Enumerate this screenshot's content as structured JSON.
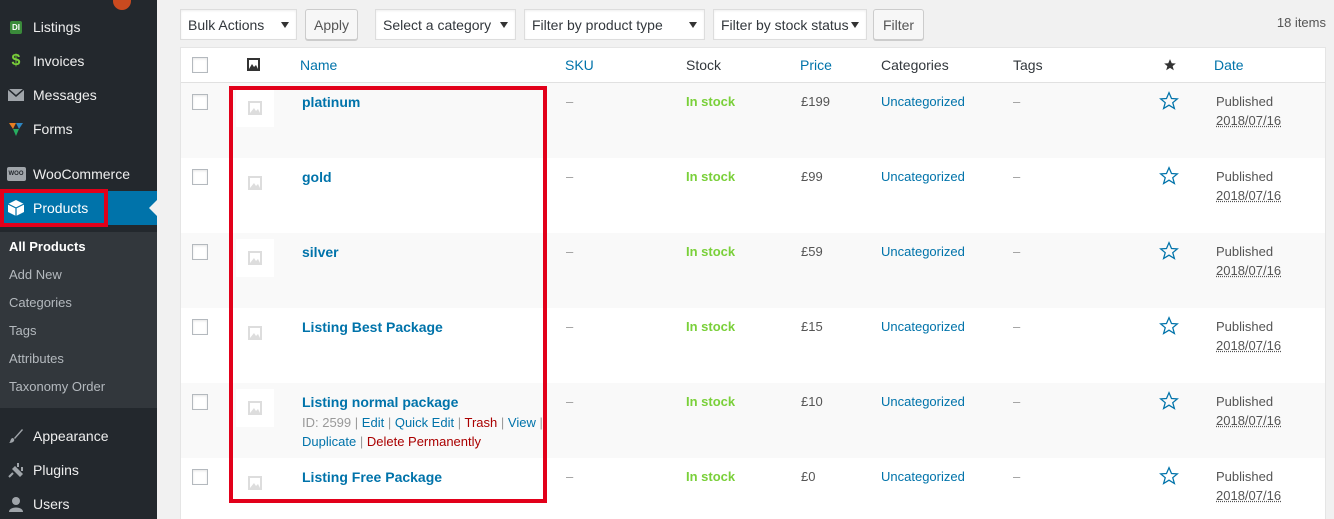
{
  "sidebar": {
    "items": [
      {
        "label": "Listings",
        "icon": "di-badge-icon"
      },
      {
        "label": "Invoices",
        "icon": "dollar-icon"
      },
      {
        "label": "Messages",
        "icon": "envelope-icon"
      },
      {
        "label": "Forms",
        "icon": "forms-icon"
      },
      {
        "label": "WooCommerce",
        "icon": "woocommerce-icon"
      },
      {
        "label": "Products",
        "icon": "box-icon"
      },
      {
        "label": "Appearance",
        "icon": "paintbrush-icon"
      },
      {
        "label": "Plugins",
        "icon": "plugin-icon"
      },
      {
        "label": "Users",
        "icon": "user-icon"
      }
    ],
    "di_badge": "DI",
    "woo_badge": "WOO",
    "submenu": [
      "All Products",
      "Add New",
      "Categories",
      "Tags",
      "Attributes",
      "Taxonomy Order"
    ]
  },
  "toolbar": {
    "bulk_actions": "Bulk Actions",
    "apply": "Apply",
    "category": "Select a category",
    "product_type": "Filter by product type",
    "stock_status": "Filter by stock status",
    "filter": "Filter",
    "items_count": "18 items"
  },
  "table": {
    "headers": {
      "name": "Name",
      "sku": "SKU",
      "stock": "Stock",
      "price": "Price",
      "categories": "Categories",
      "tags": "Tags",
      "date": "Date"
    },
    "rows": [
      {
        "name": "platinum",
        "sku": "–",
        "stock": "In stock",
        "price": "£199",
        "category": "Uncategorized",
        "tags": "–",
        "status": "Published",
        "date": "2018/07/16"
      },
      {
        "name": "gold",
        "sku": "–",
        "stock": "In stock",
        "price": "£99",
        "category": "Uncategorized",
        "tags": "–",
        "status": "Published",
        "date": "2018/07/16"
      },
      {
        "name": "silver",
        "sku": "–",
        "stock": "In stock",
        "price": "£59",
        "category": "Uncategorized",
        "tags": "–",
        "status": "Published",
        "date": "2018/07/16"
      },
      {
        "name": "Listing Best Package",
        "sku": "–",
        "stock": "In stock",
        "price": "£15",
        "category": "Uncategorized",
        "tags": "–",
        "status": "Published",
        "date": "2018/07/16"
      },
      {
        "name": "Listing normal package",
        "sku": "–",
        "stock": "In stock",
        "price": "£10",
        "category": "Uncategorized",
        "tags": "–",
        "status": "Published",
        "date": "2018/07/16"
      },
      {
        "name": "Listing Free Package",
        "sku": "–",
        "stock": "In stock",
        "price": "£0",
        "category": "Uncategorized",
        "tags": "–",
        "status": "Published",
        "date": "2018/07/16"
      }
    ],
    "row_actions": {
      "id": "ID: 2599",
      "edit": "Edit",
      "quick_edit": "Quick Edit",
      "trash": "Trash",
      "view": "View",
      "duplicate": "Duplicate",
      "delete_permanently": "Delete Permanently",
      "separator": "|"
    }
  },
  "colors": {
    "sidebar_bg": "#23282d",
    "accent": "#0073aa",
    "in_stock": "#7ad03a",
    "highlight_box": "#e2001a"
  }
}
